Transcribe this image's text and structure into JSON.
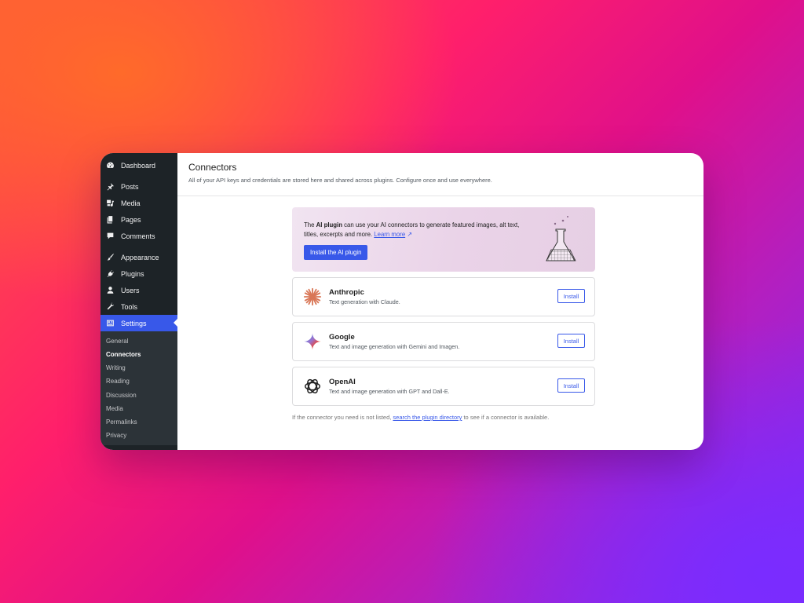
{
  "sidebar": {
    "items": [
      {
        "label": "Dashboard",
        "icon": "dashboard-icon"
      },
      {
        "label": "Posts",
        "icon": "pin-icon"
      },
      {
        "label": "Media",
        "icon": "media-icon"
      },
      {
        "label": "Pages",
        "icon": "pages-icon"
      },
      {
        "label": "Comments",
        "icon": "comment-icon"
      },
      {
        "label": "Appearance",
        "icon": "brush-icon"
      },
      {
        "label": "Plugins",
        "icon": "plug-icon"
      },
      {
        "label": "Users",
        "icon": "user-icon"
      },
      {
        "label": "Tools",
        "icon": "wrench-icon"
      },
      {
        "label": "Settings",
        "icon": "settings-icon"
      }
    ],
    "submenu": [
      "General",
      "Connectors",
      "Writing",
      "Reading",
      "Discussion",
      "Media",
      "Permalinks",
      "Privacy"
    ],
    "active_color": "#3858e9"
  },
  "header": {
    "title": "Connectors",
    "description": "All of your API keys and credentials are stored here and shared across plugins. Configure once and use everywhere."
  },
  "banner": {
    "text_prefix": "The ",
    "text_bold": "AI plugin",
    "text_rest": " can use your AI connectors to generate featured images, alt text, titles, excerpts and more. ",
    "link": "Learn more",
    "link_arrow": "↗",
    "button": "Install the AI plugin"
  },
  "connectors": [
    {
      "name": "Anthropic",
      "description": "Text generation with Claude.",
      "button": "Install",
      "logo": "anthropic-logo"
    },
    {
      "name": "Google",
      "description": "Text and image generation with Gemini and Imagen.",
      "button": "Install",
      "logo": "google-gemini-logo"
    },
    {
      "name": "OpenAI",
      "description": "Text and image generation with GPT and Dall-E.",
      "button": "Install",
      "logo": "openai-logo"
    }
  ],
  "footer": {
    "prefix": "If the connector you need is not listed, ",
    "link": "search the plugin directory",
    "suffix": " to see if a connector is available."
  }
}
